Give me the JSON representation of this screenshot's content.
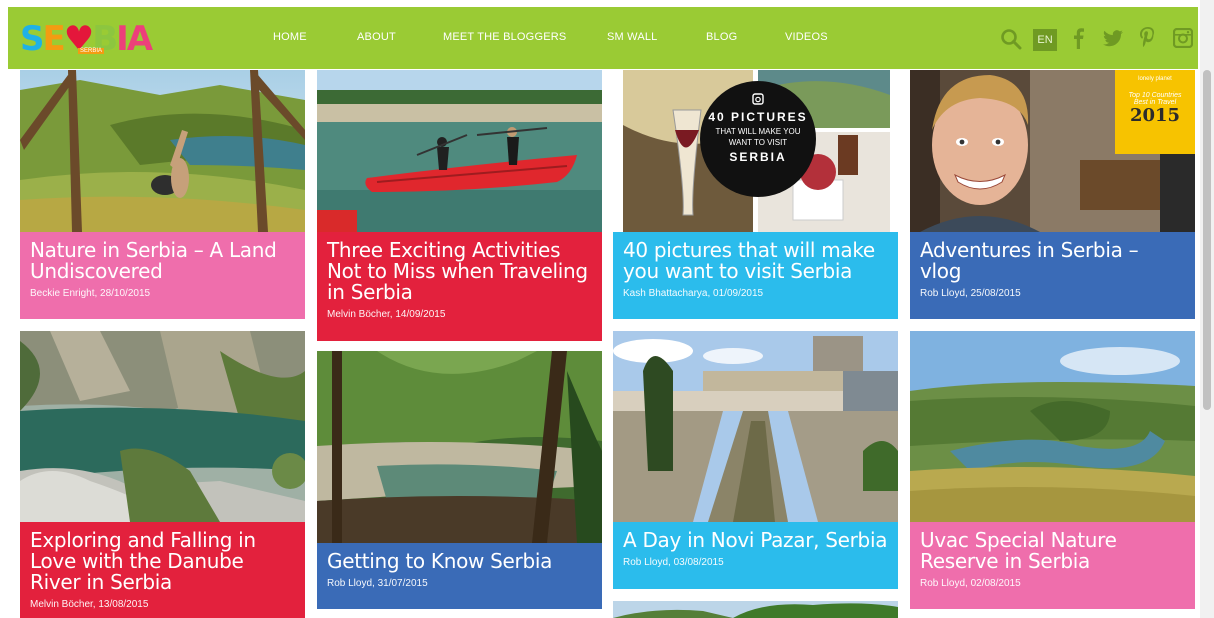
{
  "header": {
    "logo_text": "SERBIA",
    "logo_tagline": "SERBIA",
    "nav": [
      "HOME",
      "ABOUT",
      "MEET THE BLOGGERS",
      "SM WALL",
      "BLOG",
      "VIDEOS"
    ],
    "lang": "EN",
    "icons": [
      "search-icon",
      "facebook-icon",
      "twitter-icon",
      "pinterest-icon",
      "instagram-icon"
    ],
    "bar_color": "#9acb34"
  },
  "cards": [
    {
      "title": "Nature in Serbia – A Land Undiscovered",
      "meta": "Beckie Enright, 28/10/2015",
      "color": "pink"
    },
    {
      "title": "Three Exciting Activities Not to Miss when Traveling in Serbia",
      "meta": "Melvin Böcher, 14/09/2015",
      "color": "red"
    },
    {
      "title": "40 pictures that will make you want to visit Serbia",
      "meta": "Kash Bhattacharya, 01/09/2015",
      "color": "cyan"
    },
    {
      "title": "Adventures in Serbia – vlog",
      "meta": "Rob Lloyd, 25/08/2015",
      "color": "blue"
    },
    {
      "title": "Exploring and Falling in Love with the Danube River in Serbia",
      "meta": "Melvin Böcher, 13/08/2015",
      "color": "red"
    },
    {
      "title": "Getting to Know Serbia",
      "meta": "Rob Lloyd, 31/07/2015",
      "color": "blue"
    },
    {
      "title": "A Day in Novi Pazar, Serbia",
      "meta": "Rob Lloyd, 03/08/2015",
      "color": "cyan"
    },
    {
      "title": "Uvac Special Nature Reserve in Serbia",
      "meta": "Rob Lloyd, 02/08/2015",
      "color": "pink"
    }
  ],
  "overlays": {
    "pictures_badge": {
      "line1": "40 PICTURES",
      "line2": "THAT WILL MAKE YOU",
      "line3": "WANT TO VISIT",
      "line4": "SERBIA"
    },
    "lonely_planet": {
      "brand": "lonely planet",
      "line1": "Top 10 Countries",
      "line2": "Best in Travel",
      "year": "2015"
    }
  }
}
